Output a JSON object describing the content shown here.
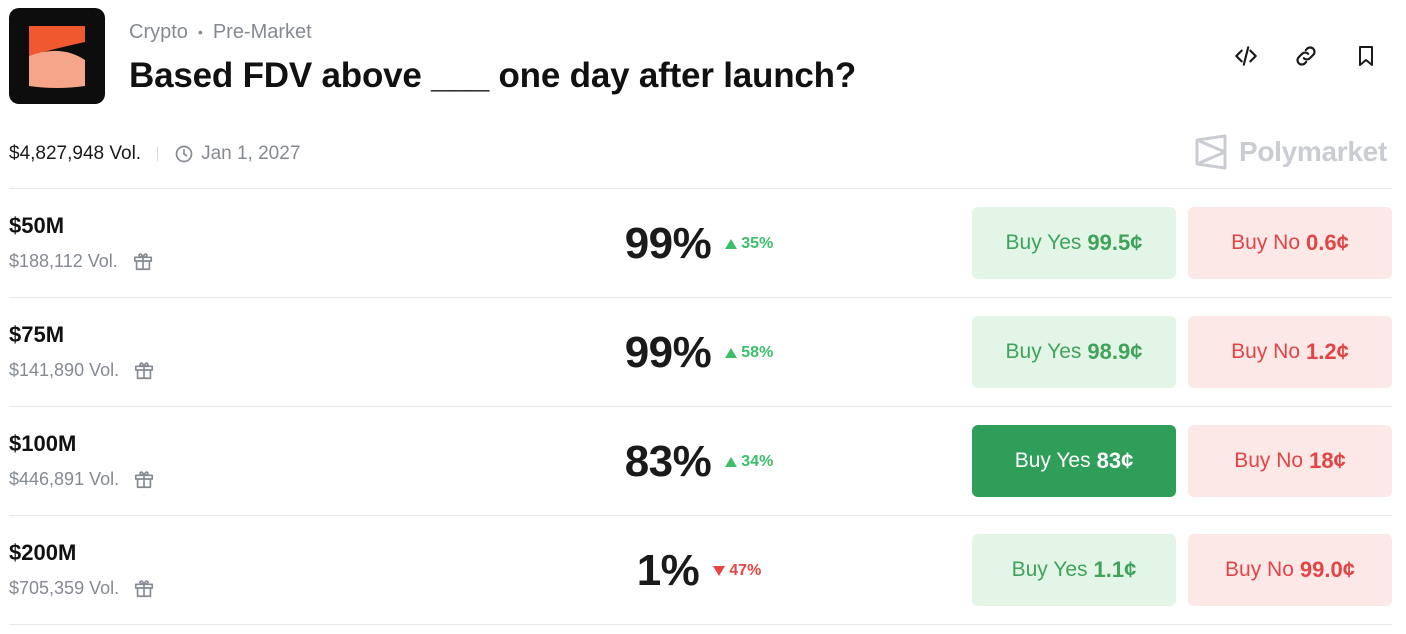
{
  "header": {
    "breadcrumb": [
      "Crypto",
      "Pre-Market"
    ],
    "title": "Based FDV above ___ one day after launch?",
    "actions": [
      "code-icon",
      "link-icon",
      "bookmark-icon"
    ]
  },
  "meta": {
    "volume": "$4,827,948 Vol.",
    "date": "Jan 1, 2027"
  },
  "brand": "Polymarket",
  "colors": {
    "green": "#3fa35b",
    "green_active": "#2f9e58",
    "red": "#e24545",
    "up": "#3dbf6a",
    "down": "#e64545"
  },
  "markets": [
    {
      "label": "$50M",
      "volume": "$188,112 Vol.",
      "percent": "99%",
      "change": "35%",
      "direction": "up",
      "yes_label": "Buy Yes",
      "yes_price": "99.5¢",
      "no_label": "Buy No",
      "no_price": "0.6¢",
      "yes_active": false
    },
    {
      "label": "$75M",
      "volume": "$141,890 Vol.",
      "percent": "99%",
      "change": "58%",
      "direction": "up",
      "yes_label": "Buy Yes",
      "yes_price": "98.9¢",
      "no_label": "Buy No",
      "no_price": "1.2¢",
      "yes_active": false
    },
    {
      "label": "$100M",
      "volume": "$446,891 Vol.",
      "percent": "83%",
      "change": "34%",
      "direction": "up",
      "yes_label": "Buy Yes",
      "yes_price": "83¢",
      "no_label": "Buy No",
      "no_price": "18¢",
      "yes_active": true
    },
    {
      "label": "$200M",
      "volume": "$705,359 Vol.",
      "percent": "1%",
      "change": "47%",
      "direction": "down",
      "yes_label": "Buy Yes",
      "yes_price": "1.1¢",
      "no_label": "Buy No",
      "no_price": "99.0¢",
      "yes_active": false
    }
  ]
}
